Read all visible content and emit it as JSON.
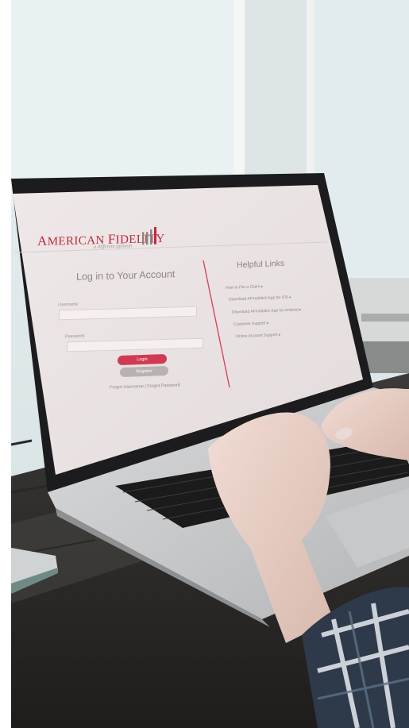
{
  "brand": {
    "name_part1": "A",
    "name_part2": "MERICAN ",
    "name_part3": "F",
    "name_part4": "IDELITY",
    "tagline": "a different opinion"
  },
  "login": {
    "title": "Log in to Your Account",
    "username_label": "Username",
    "password_label": "Password",
    "login_button": "Login",
    "register_button": "Register",
    "forgot_links": "Forgot Username | Forgot Password"
  },
  "helpful_links": {
    "title": "Helpful Links",
    "items": [
      "How to File a Claim ▸",
      "Download AFmobile® App for iOS ▸",
      "Download AFmobile® App for Android ▸",
      "Customer Support ▸",
      "Online Account Support ▸"
    ]
  },
  "colors": {
    "brand_red": "#c0283a",
    "button_red": "#cf3b53",
    "button_gray": "#b9b2b3",
    "screen_bg": "#ede5e5"
  }
}
